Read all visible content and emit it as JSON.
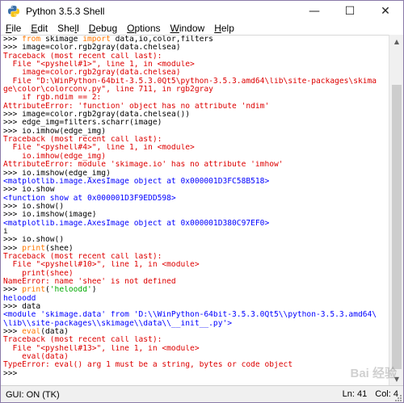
{
  "window": {
    "title": "Python 3.5.3 Shell",
    "controls": {
      "minimize": "—",
      "maximize": "☐",
      "close": "✕"
    }
  },
  "menu": {
    "items": [
      {
        "pre": "",
        "acc": "F",
        "post": "ile"
      },
      {
        "pre": "",
        "acc": "E",
        "post": "dit"
      },
      {
        "pre": "She",
        "acc": "l",
        "post": "l"
      },
      {
        "pre": "",
        "acc": "D",
        "post": "ebug"
      },
      {
        "pre": "",
        "acc": "O",
        "post": "ptions"
      },
      {
        "pre": "",
        "acc": "W",
        "post": "indow"
      },
      {
        "pre": "",
        "acc": "H",
        "post": "elp"
      }
    ]
  },
  "shell": {
    "lines": [
      [
        {
          "t": ">>> ",
          "c": "prompt"
        },
        {
          "t": "from",
          "c": "kw"
        },
        {
          "t": " skimage ",
          "c": "code"
        },
        {
          "t": "import",
          "c": "kw"
        },
        {
          "t": " data,io,color,filters",
          "c": "code"
        }
      ],
      [
        {
          "t": ">>> ",
          "c": "prompt"
        },
        {
          "t": "image=color.rgb2gray(data.chelsea)",
          "c": "code"
        }
      ],
      [
        {
          "t": "Traceback (most recent call last):",
          "c": "out-red"
        }
      ],
      [
        {
          "t": "  File \"<pyshell#1>\", line 1, in <module>",
          "c": "out-red"
        }
      ],
      [
        {
          "t": "    image=color.rgb2gray(data.chelsea)",
          "c": "out-red"
        }
      ],
      [
        {
          "t": "  File \"D:\\WinPython-64bit-3.5.3.0Qt5\\python-3.5.3.amd64\\lib\\site-packages\\skima",
          "c": "out-red"
        }
      ],
      [
        {
          "t": "ge\\color\\colorconv.py\", line 711, in rgb2gray",
          "c": "out-red"
        }
      ],
      [
        {
          "t": "    if rgb.ndim == 2:",
          "c": "out-red"
        }
      ],
      [
        {
          "t": "AttributeError: 'function' object has no attribute 'ndim'",
          "c": "out-red"
        }
      ],
      [
        {
          "t": ">>> ",
          "c": "prompt"
        },
        {
          "t": "image=color.rgb2gray(data.chelsea())",
          "c": "code"
        }
      ],
      [
        {
          "t": ">>> ",
          "c": "prompt"
        },
        {
          "t": "edge_img=filters.scharr(image)",
          "c": "code"
        }
      ],
      [
        {
          "t": ">>> ",
          "c": "prompt"
        },
        {
          "t": "io.imhow(edge_img)",
          "c": "code"
        }
      ],
      [
        {
          "t": "Traceback (most recent call last):",
          "c": "out-red"
        }
      ],
      [
        {
          "t": "  File \"<pyshell#4>\", line 1, in <module>",
          "c": "out-red"
        }
      ],
      [
        {
          "t": "    io.imhow(edge_img)",
          "c": "out-red"
        }
      ],
      [
        {
          "t": "AttributeError: module 'skimage.io' has no attribute 'imhow'",
          "c": "out-red"
        }
      ],
      [
        {
          "t": ">>> ",
          "c": "prompt"
        },
        {
          "t": "io.imshow(edge_img)",
          "c": "code"
        }
      ],
      [
        {
          "t": "<matplotlib.image.AxesImage object at 0x000001D3FC58B518>",
          "c": "out-blue"
        }
      ],
      [
        {
          "t": ">>> ",
          "c": "prompt"
        },
        {
          "t": "io.show",
          "c": "code"
        }
      ],
      [
        {
          "t": "<function show at 0x000001D3F9EDD598>",
          "c": "out-blue"
        }
      ],
      [
        {
          "t": ">>> ",
          "c": "prompt"
        },
        {
          "t": "io.show()",
          "c": "code"
        }
      ],
      [
        {
          "t": ">>> ",
          "c": "prompt"
        },
        {
          "t": "io.imshow(image)",
          "c": "code"
        }
      ],
      [
        {
          "t": "<matplotlib.image.AxesImage object at 0x000001D380C97EF0>",
          "c": "out-blue"
        }
      ],
      [
        {
          "t": "i",
          "c": "code"
        }
      ],
      [
        {
          "t": ">>> ",
          "c": "prompt"
        },
        {
          "t": "io.show()",
          "c": "code"
        }
      ],
      [
        {
          "t": ">>> ",
          "c": "prompt"
        },
        {
          "t": "print",
          "c": "kw"
        },
        {
          "t": "(shee)",
          "c": "code"
        }
      ],
      [
        {
          "t": "Traceback (most recent call last):",
          "c": "out-red"
        }
      ],
      [
        {
          "t": "  File \"<pyshell#10>\", line 1, in <module>",
          "c": "out-red"
        }
      ],
      [
        {
          "t": "    print(shee)",
          "c": "out-red"
        }
      ],
      [
        {
          "t": "NameError: name 'shee' is not defined",
          "c": "out-red"
        }
      ],
      [
        {
          "t": ">>> ",
          "c": "prompt"
        },
        {
          "t": "print",
          "c": "kw"
        },
        {
          "t": "(",
          "c": "code"
        },
        {
          "t": "'heloodd'",
          "c": "str"
        },
        {
          "t": ")",
          "c": "code"
        }
      ],
      [
        {
          "t": "heloodd",
          "c": "out-blue"
        }
      ],
      [
        {
          "t": ">>> ",
          "c": "prompt"
        },
        {
          "t": "data",
          "c": "code"
        }
      ],
      [
        {
          "t": "<module 'skimage.data' from 'D:\\\\WinPython-64bit-3.5.3.0Qt5\\\\python-3.5.3.amd64\\",
          "c": "out-blue"
        }
      ],
      [
        {
          "t": "\\lib\\\\site-packages\\\\skimage\\\\data\\\\__init__.py'>",
          "c": "out-blue"
        }
      ],
      [
        {
          "t": ">>> ",
          "c": "prompt"
        },
        {
          "t": "eval",
          "c": "kw"
        },
        {
          "t": "(data)",
          "c": "code"
        }
      ],
      [
        {
          "t": "Traceback (most recent call last):",
          "c": "out-red"
        }
      ],
      [
        {
          "t": "  File \"<pyshell#13>\", line 1, in <module>",
          "c": "out-red"
        }
      ],
      [
        {
          "t": "    eval(data)",
          "c": "out-red"
        }
      ],
      [
        {
          "t": "TypeError: eval() arg 1 must be a string, bytes or code object",
          "c": "out-red"
        }
      ],
      [
        {
          "t": ">>> ",
          "c": "prompt"
        }
      ]
    ]
  },
  "status": {
    "left": "GUI: ON (TK)",
    "line": "Ln: 41",
    "col": "Col: 4"
  },
  "watermark": "Bai 经验",
  "colors": {
    "prompt": "#000000",
    "keyword": "#ff7700",
    "string": "#00aa00",
    "stdout": "#0000ff",
    "stderr": "#dd0000"
  }
}
